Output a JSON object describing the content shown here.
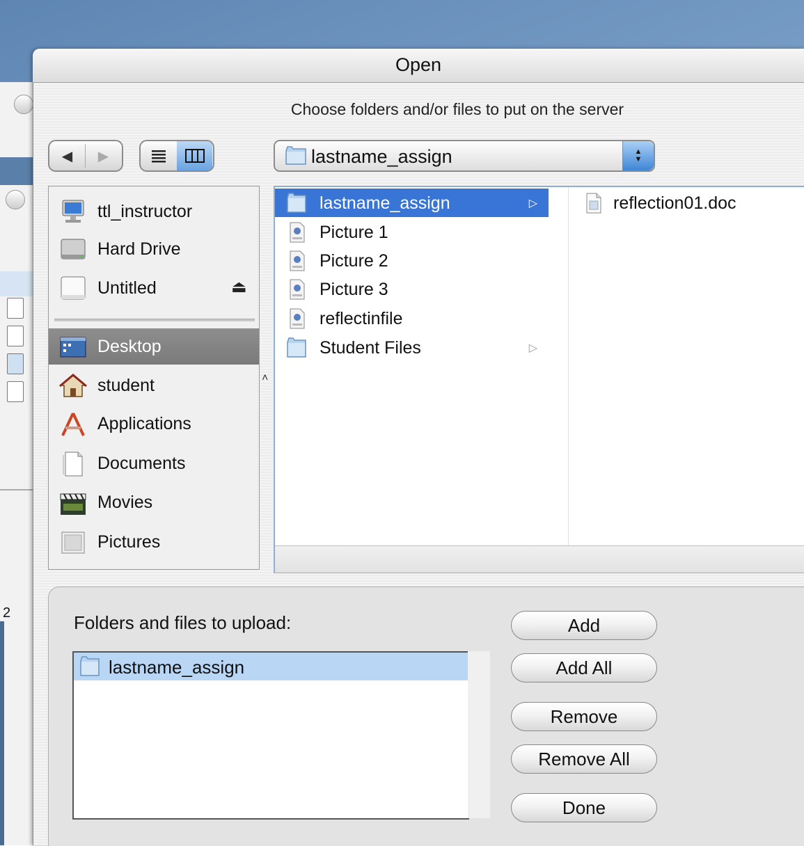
{
  "dialog": {
    "title": "Open",
    "prompt": "Choose folders and/or files to put on the server"
  },
  "toolbar": {
    "back_glyph": "◀",
    "forward_glyph": "▶",
    "path_value": "lastname_assign"
  },
  "sidebar": {
    "devices": [
      {
        "label": "ttl_instructor",
        "icon": "computer-icon"
      },
      {
        "label": "Hard Drive",
        "icon": "hard-drive-icon"
      },
      {
        "label": "Untitled",
        "icon": "disk-icon",
        "eject": "⏏"
      }
    ],
    "places": [
      {
        "label": "Desktop",
        "icon": "desktop-icon",
        "selected": true
      },
      {
        "label": "student",
        "icon": "home-icon"
      },
      {
        "label": "Applications",
        "icon": "applications-icon"
      },
      {
        "label": "Documents",
        "icon": "documents-icon"
      },
      {
        "label": "Movies",
        "icon": "movies-icon"
      },
      {
        "label": "Pictures",
        "icon": "pictures-icon"
      }
    ]
  },
  "browser": {
    "column1": [
      {
        "label": "lastname_assign",
        "icon": "folder-icon",
        "selected": true,
        "arrow": "▷"
      },
      {
        "label": "Picture 1",
        "icon": "pdf-file-icon"
      },
      {
        "label": "Picture 2",
        "icon": "pdf-file-icon"
      },
      {
        "label": "Picture 3",
        "icon": "pdf-file-icon"
      },
      {
        "label": "reflectinfile",
        "icon": "pdf-file-icon"
      },
      {
        "label": "Student Files",
        "icon": "folder-icon",
        "arrow": "▷"
      }
    ],
    "column2": [
      {
        "label": "reflection01.doc",
        "icon": "document-file-icon"
      }
    ]
  },
  "upload": {
    "label": "Folders and files to upload:",
    "items": [
      {
        "label": "lastname_assign",
        "icon": "folder-icon"
      }
    ]
  },
  "buttons": {
    "add": "Add",
    "add_all": "Add All",
    "remove": "Remove",
    "remove_all": "Remove All",
    "done": "Done"
  },
  "background": {
    "partial_number": "2"
  },
  "colors": {
    "selection_blue": "#3875d7",
    "sidebar_selection": "#808080",
    "upload_selection": "#b9d6f5"
  }
}
